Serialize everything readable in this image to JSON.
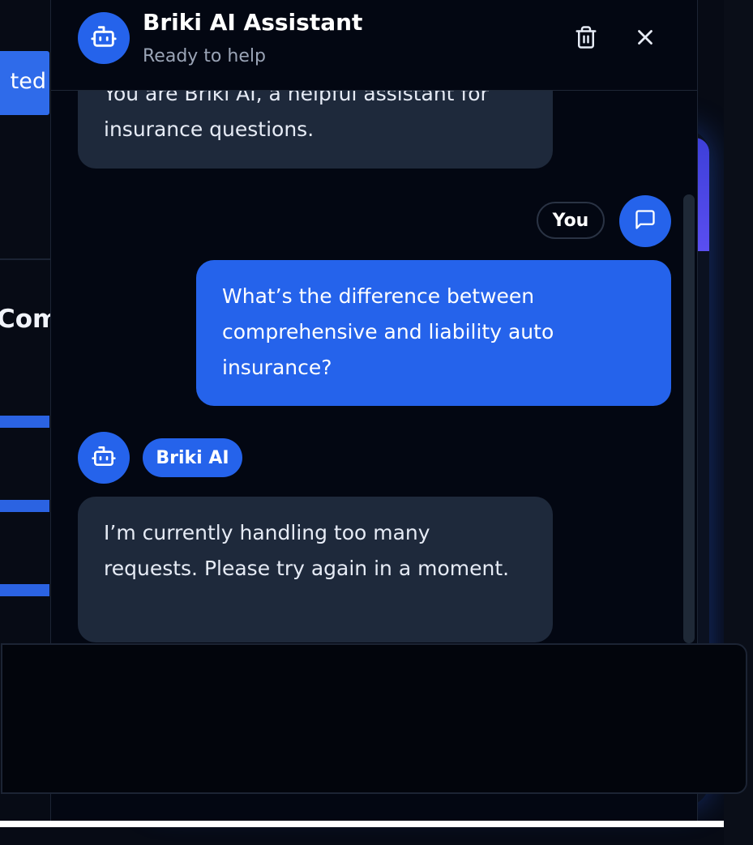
{
  "background": {
    "button_fragment": "ted",
    "heading_fragment": "Com"
  },
  "chat": {
    "title": "Briki AI Assistant",
    "status": "Ready to help",
    "messages": {
      "system": "You are Briki AI, a helpful assistant for insurance questions.",
      "user_label": "You",
      "user": "What’s the difference between comprehensive and liability auto insurance?",
      "bot_label": "Briki AI",
      "bot": "I’m currently handling too many requests. Please try again in a moment."
    },
    "input": {
      "placeholder": "",
      "value": ""
    }
  },
  "icons": {
    "header_avatar": "robot-icon",
    "delete": "trash-icon",
    "close": "close-icon",
    "user_avatar": "chat-bubble-icon",
    "bot_avatar": "robot-icon"
  },
  "colors": {
    "accent": "#2563eb",
    "panel_bg": "#030712",
    "bot_bubble": "#1e293b",
    "muted_text": "#9aa4b6"
  }
}
